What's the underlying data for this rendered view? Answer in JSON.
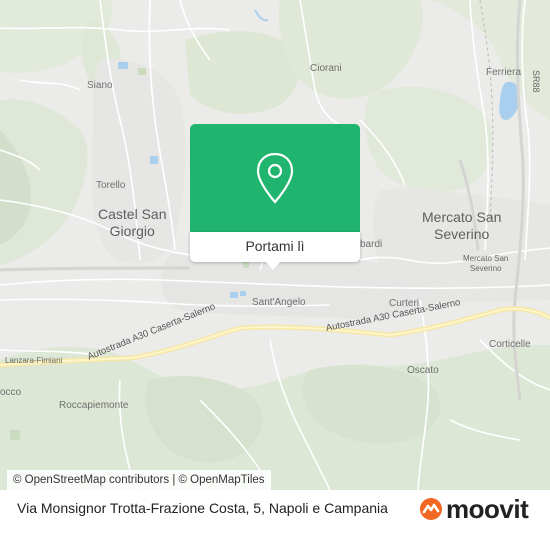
{
  "map": {
    "towns": [
      {
        "name": "Siano",
        "kind": "small"
      },
      {
        "name": "Ciorani",
        "kind": "small"
      },
      {
        "name": "Ferriera",
        "kind": "small"
      },
      {
        "name": "Torello",
        "kind": "small"
      },
      {
        "name": "Castel San\nGiorgio",
        "kind": "town"
      },
      {
        "name": "Mercato San\nSeverino",
        "kind": "town"
      },
      {
        "name": "Mercato San\nSeverino",
        "kind": "tiny"
      },
      {
        "name": "Sant'Angelo",
        "kind": "small"
      },
      {
        "name": "Curteri",
        "kind": "small"
      },
      {
        "name": "Corticelle",
        "kind": "small"
      },
      {
        "name": "Oscato",
        "kind": "small"
      },
      {
        "name": "Lanzara-Fimiani",
        "kind": "tiny"
      },
      {
        "name": "Roccapiemonte",
        "kind": "small"
      },
      {
        "name": "occo",
        "kind": "small"
      },
      {
        "name": "bardi",
        "kind": "small"
      }
    ],
    "roads": [
      {
        "name": "Autostrada A30 Caserta-Salerno"
      },
      {
        "name": "Autostrada A30 Caserta-Salerno"
      }
    ],
    "vertical_road_label": "SR88"
  },
  "popup": {
    "button_label": "Portami lì",
    "pin_icon": "map-pin-icon",
    "color": "#20b56e"
  },
  "attribution": "© OpenStreetMap contributors | © OpenMapTiles",
  "footer": {
    "address": "Via Monsignor Trotta-Frazione Costa, 5, Napoli e Campania",
    "brand": "moovit",
    "brand_color": "#f26722"
  }
}
